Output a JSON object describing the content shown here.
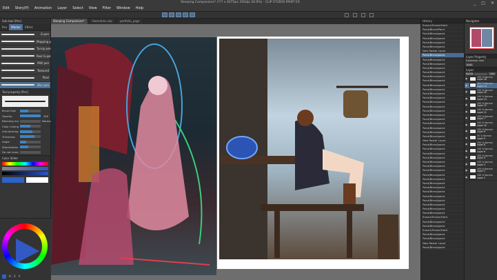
{
  "menu": [
    "Edit",
    "Story(P)",
    "Animation",
    "Layer",
    "Select",
    "View",
    "Filter",
    "Window",
    "Help"
  ],
  "document_title": "Sleeping Companions* (??? x 4075px 350dpi 20.0%) - CLIP STUDIO PAINT EX",
  "window_controls": [
    "_",
    "□",
    "✕"
  ],
  "tabs": [
    "Sleeping Companions*",
    "illustration.clip",
    "portfolio_page"
  ],
  "subtool": {
    "header": "Sub tool (Pen)",
    "tabs": [
      "Pen",
      "Marker",
      "Effect"
    ],
    "brushes": [
      {
        "name": "G-pen"
      },
      {
        "name": "Mapping pen"
      },
      {
        "name": "Turnip pen"
      },
      {
        "name": "Real G-pen"
      },
      {
        "name": "Milli pen"
      },
      {
        "name": "Textured"
      },
      {
        "name": "Pixel"
      },
      {
        "name": "Blur pen"
      }
    ],
    "selected_index": 7
  },
  "tool_property": {
    "header": "Tool property [Pen]",
    "rows": [
      {
        "label": "Brush Size",
        "value": "",
        "fill": 0.4
      },
      {
        "label": "Opacity",
        "value": "100",
        "fill": 1.0
      },
      {
        "label": "Blending mode",
        "value": "Normal",
        "fill": 0.0
      },
      {
        "label": "Color mixing",
        "value": "",
        "fill": 0.5
      },
      {
        "label": "Anti-aliasing",
        "value": "",
        "fill": 0.6
      },
      {
        "label": "Thickness",
        "value": "",
        "fill": 0.7
      },
      {
        "label": "Angle",
        "value": "",
        "fill": 0.3
      },
      {
        "label": "Stabilization",
        "value": "",
        "fill": 0.4
      },
      {
        "label": "Do not cross lines of reference layer",
        "value": "",
        "fill": 0.0
      }
    ]
  },
  "color": {
    "header": "Color Slider",
    "main_color": "#2d62c9",
    "sub_color": "#ffffff",
    "wheel_label": "Color Wheel",
    "footer": [
      "H",
      "S",
      "V"
    ]
  },
  "right_strip": {
    "header": "History",
    "items": [
      "Eraser/Eraser/Hard",
      "Paint/Blend/Paint",
      "Paint/Blend/paint",
      "Paint/Blend/paint",
      "Paint/Blend/paint",
      "Paint/Blend/paint",
      "New Raster Layer",
      "Paint/Blend/paint",
      "Paint/Blend/paint",
      "Paint/Blend/paint",
      "Paint/Blend/paint",
      "Paint/Blend/paint",
      "Paint/Blend/paint",
      "Paint/Blend/paint",
      "Paint/Blend/paint",
      "Paint/Blend/paint",
      "Paint/Blend/paint",
      "Paint/Blend/paint",
      "Paint/Blend/paint",
      "Paint/Blend/paint",
      "Paint/Blend/paint",
      "Paint/Blend/paint",
      "Paint/Blend/paint",
      "Paint/Blend/paint",
      "Paint/Blend/paint",
      "Paint/Blend/paint",
      "Paint/Blend/paint",
      "New Raster Layer",
      "Paint/Blend/paint",
      "Paint/Blend/paint",
      "Paint/Blend/paint",
      "Paint/Blend/paint",
      "Paint/Blend/paint",
      "Paint/Blend/paint",
      "Paint/Blend/paint",
      "Paint/Blend/paint",
      "Paint/Blend/paint",
      "Paint/Blend/paint",
      "Paint/Blend/paint",
      "Paint/Blend/paint",
      "Paint/Blend/paint",
      "Paint/Blend/paint",
      "Paint/Blend/paint",
      "Paint/Blend/paint",
      "Paint/Blend/paint",
      "Eraser/Eraser/Hard",
      "Paint/Blend/paint",
      "Paint/Blend/paint",
      "Eraser/Eraser/Hard",
      "Paint/Blend/paint",
      "Paint/Blend/paint",
      "New Raster Layer",
      "Paint/Blend/paint"
    ],
    "selected_index": 7
  },
  "navigator": {
    "header": "Navigator",
    "zoom": "20.0"
  },
  "layer_property": {
    "header": "Layer Property",
    "expression": "Expression color",
    "mode": "Color"
  },
  "layers_panel": {
    "header": "Layer",
    "blend": "Normal",
    "opacity": "100",
    "layers": [
      {
        "pct": "100 % Normal",
        "name": "Layer 18"
      },
      {
        "pct": "100 % Normal",
        "name": "Layer 14"
      },
      {
        "pct": "100 % Normal",
        "name": "Layer 20"
      },
      {
        "pct": "100 % Normal",
        "name": "Layer 13"
      },
      {
        "pct": "100 % Normal",
        "name": "Layer 12"
      },
      {
        "pct": "100 % Normal",
        "name": "Layer 11"
      },
      {
        "pct": "100 % Normal",
        "name": "Layer 7"
      },
      {
        "pct": "100 % Normal",
        "name": "Layer 10"
      },
      {
        "pct": "100 % Normal",
        "name": "Layer 9"
      },
      {
        "pct": "50 % Normal",
        "name": "Layer 5"
      },
      {
        "pct": "100 % Normal",
        "name": "Layer 8"
      },
      {
        "pct": "100 % Normal",
        "name": "Layer 6"
      },
      {
        "pct": "100 % Normal",
        "name": "Layer 4"
      },
      {
        "pct": "100 % Normal",
        "name": "Layer 3"
      },
      {
        "pct": "100 % Normal",
        "name": "Layer 2"
      },
      {
        "pct": "100 % Normal",
        "name": "Layer 1"
      }
    ],
    "selected_index": 1
  }
}
